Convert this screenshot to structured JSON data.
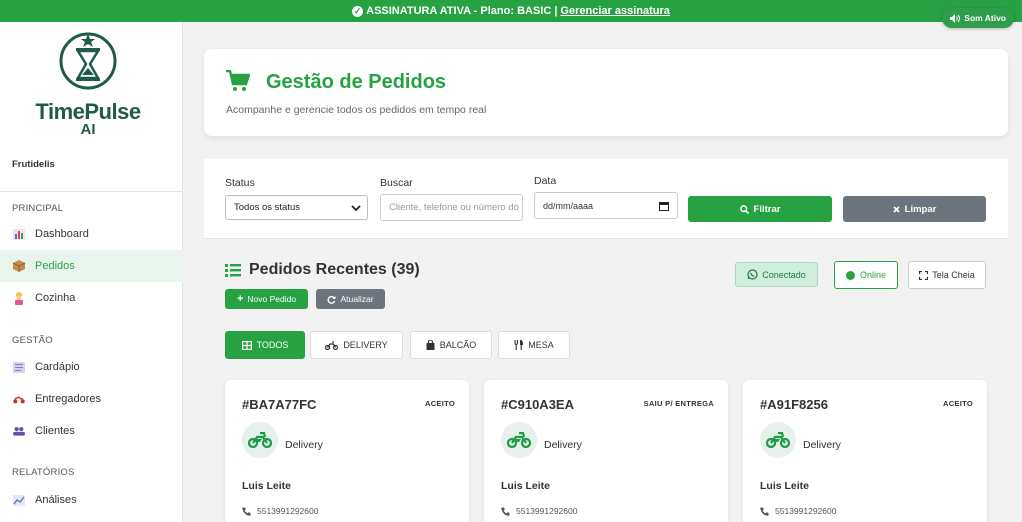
{
  "banner": {
    "text": "ASSINATURA ATIVA - Plano: BASIC |",
    "link": "Gerenciar assinatura",
    "sound_button": "Som Ativo"
  },
  "sidebar": {
    "logo_name": "TimePulse",
    "logo_suffix": "AI",
    "store_name": "Frutidelis",
    "sections": {
      "principal": "PRINCIPAL",
      "gestao": "GESTÃO",
      "relatorios": "RELATÓRIOS"
    },
    "items": [
      {
        "label": "Dashboard",
        "icon": "chart-icon"
      },
      {
        "label": "Pedidos",
        "icon": "package-icon",
        "active": true
      },
      {
        "label": "Cozinha",
        "icon": "cook-icon"
      },
      {
        "label": "Cardápio",
        "icon": "menu-icon"
      },
      {
        "label": "Entregadores",
        "icon": "motorcycle-icon"
      },
      {
        "label": "Clientes",
        "icon": "users-icon"
      },
      {
        "label": "Análises",
        "icon": "analytics-icon"
      }
    ]
  },
  "header": {
    "title": "Gestão de Pedidos",
    "subtitle": "Acompanhe e gerencie todos os pedidos em tempo real"
  },
  "filters": {
    "status_label": "Status",
    "status_value": "Todos os status",
    "search_label": "Buscar",
    "search_placeholder": "Cliente, telefone ou número do",
    "date_label": "Data",
    "date_placeholder": "dd/mm/aaaa",
    "filter_button": "Filtrar",
    "clear_button": "Limpar"
  },
  "orders": {
    "title": "Pedidos Recentes (39)",
    "new_button": "Novo Pedido",
    "update_button": "Atualizar",
    "connected": "Conectado",
    "online": "Online",
    "fullscreen": "Tela Cheia",
    "tabs": [
      "TODOS",
      "DELIVERY",
      "BALCÃO",
      "MESA"
    ],
    "cards": [
      {
        "id": "#BA7A77FC",
        "status": "ACEITO",
        "type": "Delivery",
        "customer": "Luis Leite",
        "phone": "5513991292600"
      },
      {
        "id": "#C910A3EA",
        "status": "SAIU P/ ENTREGA",
        "type": "Delivery",
        "customer": "Luis Leite",
        "phone": "5513991292600"
      },
      {
        "id": "#A91F8256",
        "status": "ACEITO",
        "type": "Delivery",
        "customer": "Luis Leite",
        "phone": "5513991292600"
      }
    ]
  },
  "colors": {
    "primary": "#27a243",
    "secondary": "#6c757d",
    "brand_dark": "#1f5a4a"
  }
}
